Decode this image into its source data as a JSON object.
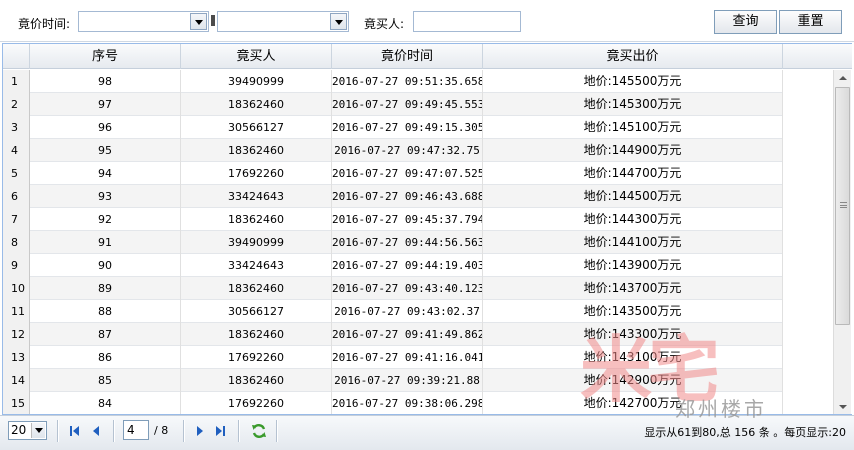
{
  "search": {
    "bid_time_label": "竟价时间:",
    "bidder_label": "竟买人:",
    "date_from_value": "",
    "date_to_value": "",
    "bidder_value": "",
    "query_button": "查询",
    "reset_button": "重置"
  },
  "grid": {
    "columns": [
      "序号",
      "竟买人",
      "竟价时间",
      "竟买出价"
    ],
    "rows": [
      {
        "n": "1",
        "seq": "98",
        "bidder": "39490999",
        "time": "2016-07-27 09:51:35.658",
        "price": "地价:145500万元"
      },
      {
        "n": "2",
        "seq": "97",
        "bidder": "18362460",
        "time": "2016-07-27 09:49:45.553",
        "price": "地价:145300万元"
      },
      {
        "n": "3",
        "seq": "96",
        "bidder": "30566127",
        "time": "2016-07-27 09:49:15.305",
        "price": "地价:145100万元"
      },
      {
        "n": "4",
        "seq": "95",
        "bidder": "18362460",
        "time": "2016-07-27 09:47:32.75",
        "price": "地价:144900万元"
      },
      {
        "n": "5",
        "seq": "94",
        "bidder": "17692260",
        "time": "2016-07-27 09:47:07.525",
        "price": "地价:144700万元"
      },
      {
        "n": "6",
        "seq": "93",
        "bidder": "33424643",
        "time": "2016-07-27 09:46:43.688",
        "price": "地价:144500万元"
      },
      {
        "n": "7",
        "seq": "92",
        "bidder": "18362460",
        "time": "2016-07-27 09:45:37.794",
        "price": "地价:144300万元"
      },
      {
        "n": "8",
        "seq": "91",
        "bidder": "39490999",
        "time": "2016-07-27 09:44:56.563",
        "price": "地价:144100万元"
      },
      {
        "n": "9",
        "seq": "90",
        "bidder": "33424643",
        "time": "2016-07-27 09:44:19.403",
        "price": "地价:143900万元"
      },
      {
        "n": "10",
        "seq": "89",
        "bidder": "18362460",
        "time": "2016-07-27 09:43:40.123",
        "price": "地价:143700万元"
      },
      {
        "n": "11",
        "seq": "88",
        "bidder": "30566127",
        "time": "2016-07-27 09:43:02.37",
        "price": "地价:143500万元"
      },
      {
        "n": "12",
        "seq": "87",
        "bidder": "18362460",
        "time": "2016-07-27 09:41:49.862",
        "price": "地价:143300万元"
      },
      {
        "n": "13",
        "seq": "86",
        "bidder": "17692260",
        "time": "2016-07-27 09:41:16.041",
        "price": "地价:143100万元"
      },
      {
        "n": "14",
        "seq": "85",
        "bidder": "18362460",
        "time": "2016-07-27 09:39:21.88",
        "price": "地价:142900万元"
      },
      {
        "n": "15",
        "seq": "84",
        "bidder": "17692260",
        "time": "2016-07-27 09:38:06.298",
        "price": "地价:142700万元"
      }
    ]
  },
  "pager": {
    "page_size": "20",
    "current_page": "4",
    "total_pages": "/ 8",
    "info": "显示从61到80,总 156 条 。每页显示:20"
  },
  "watermark": {
    "big_text": "米宅",
    "small_text": "郑州楼市"
  },
  "icons": {
    "first": "first-page-icon",
    "prev": "prev-page-icon",
    "next": "next-page-icon",
    "last": "last-page-icon",
    "refresh": "refresh-icon"
  }
}
